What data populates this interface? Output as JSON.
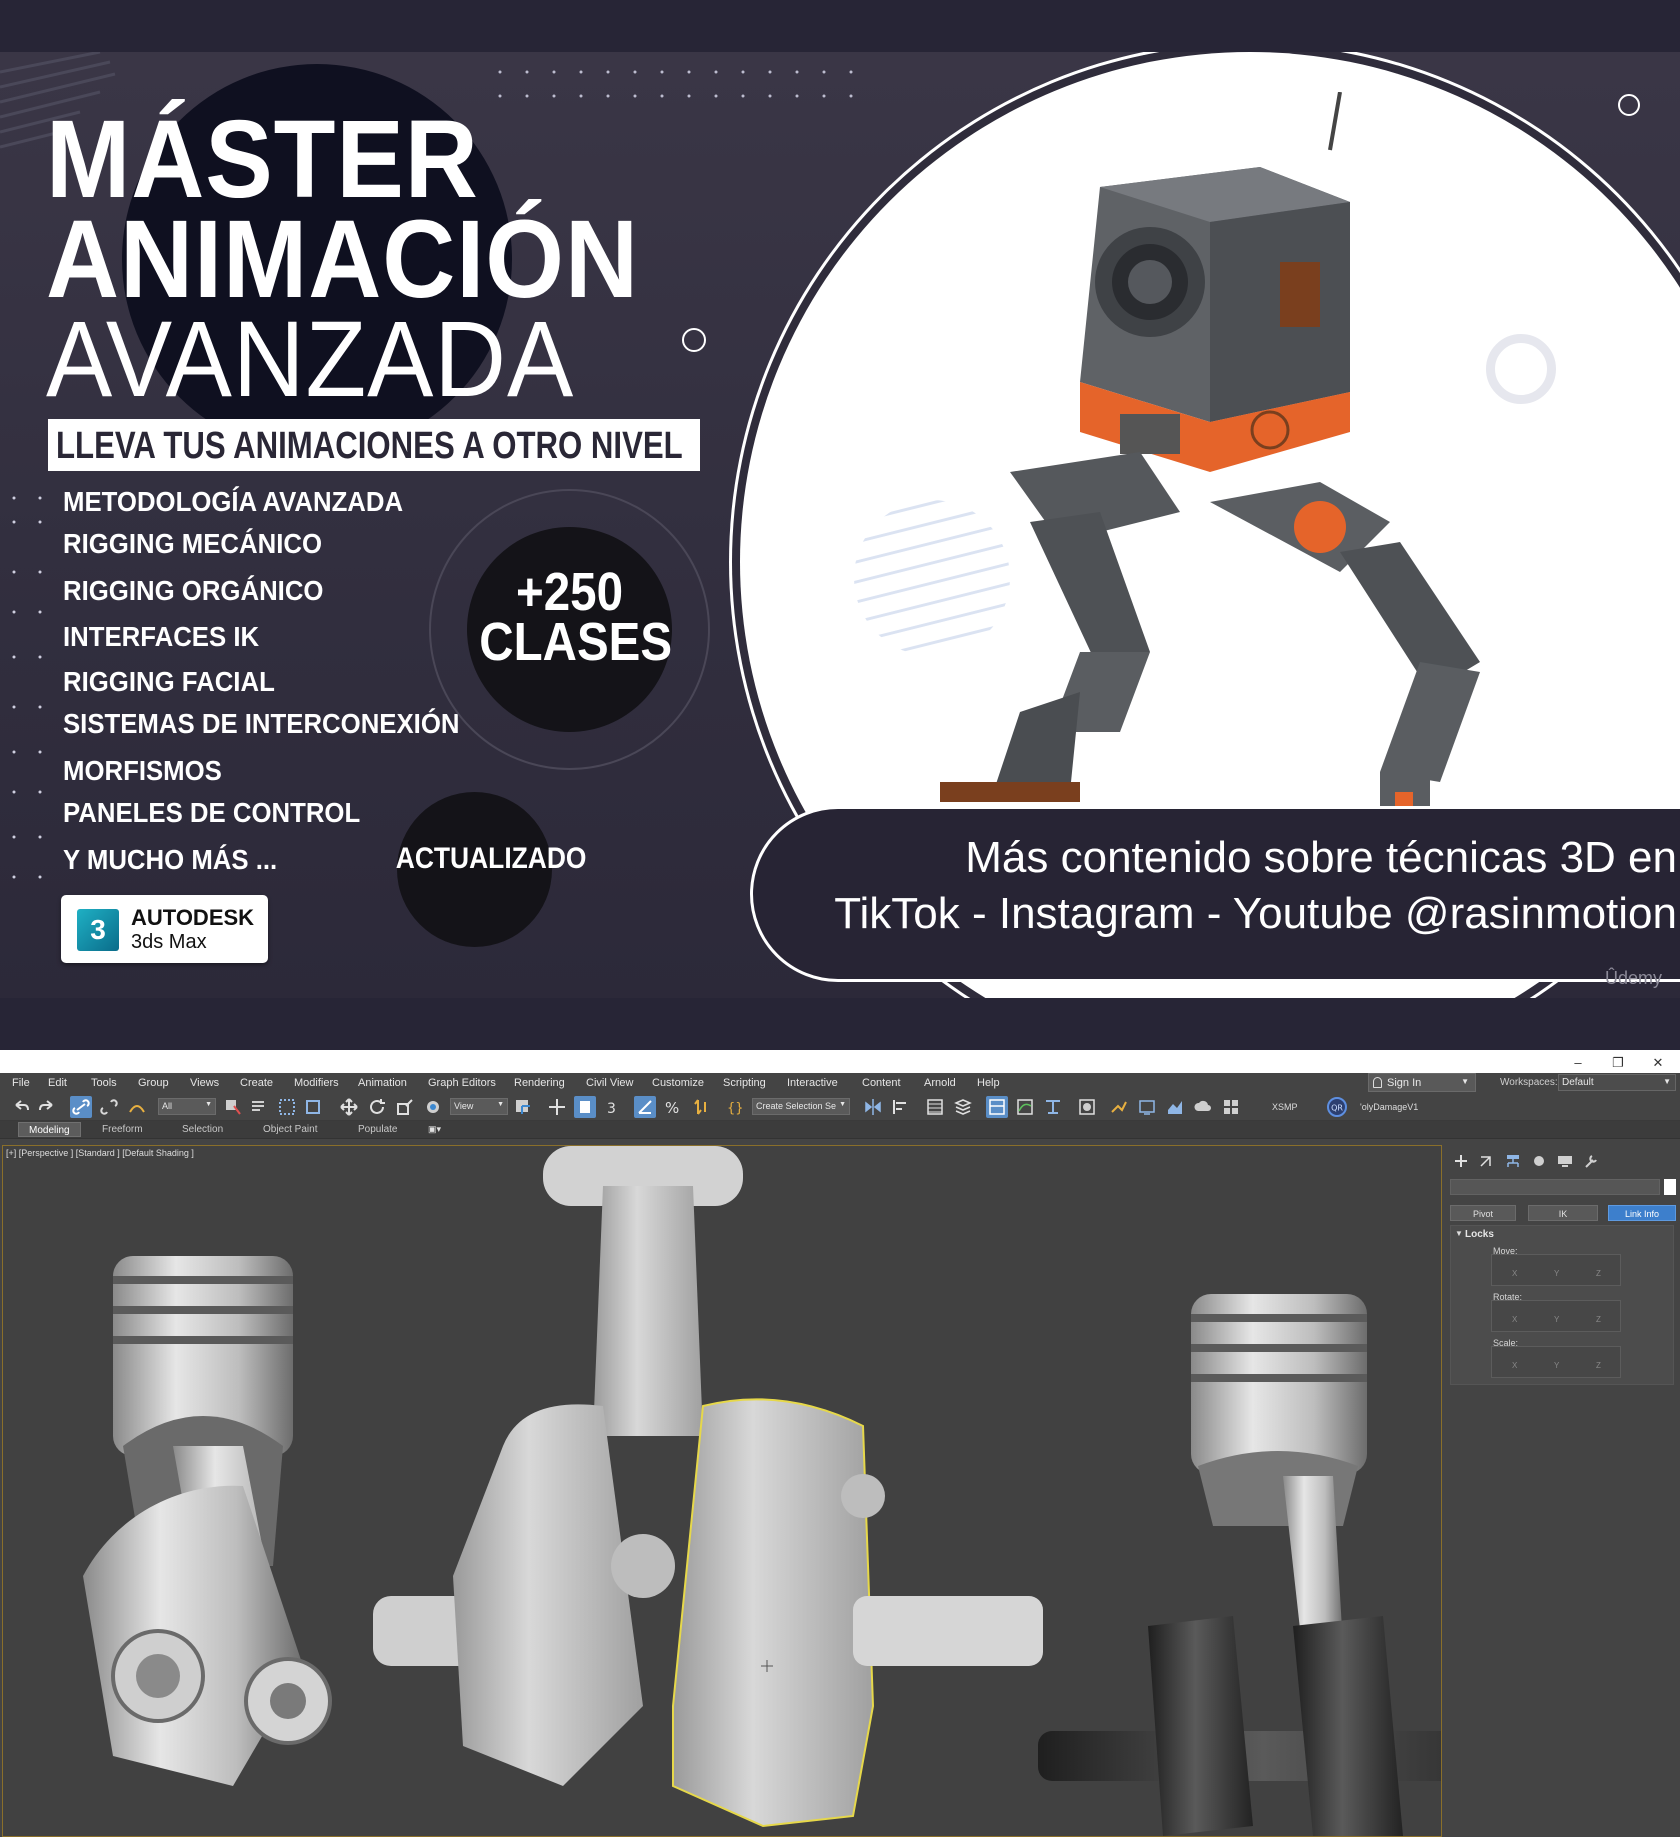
{
  "banner": {
    "title_line1": "MÁSTER",
    "title_line2": "ANIMACIÓN",
    "title_line3": "AVANZADA",
    "subtitle": "LLEVA TUS ANIMACIONES A OTRO NIVEL",
    "features": [
      "METODOLOGÍA AVANZADA",
      "RIGGING MECÁNICO",
      "RIGGING ORGÁNICO",
      "INTERFACES IK",
      "RIGGING FACIAL",
      "SISTEMAS DE INTERCONEXIÓN",
      "MORFISMOS",
      "PANELES DE CONTROL",
      "Y MUCHO MÁS ..."
    ],
    "badge_count": "+250",
    "badge_unit": "CLASES",
    "badge_updated": "ACTUALIZADO",
    "logo_number": "3",
    "logo_brand": "AUTODESK",
    "logo_product": "3ds Max",
    "info_line1": "Más contenido sobre técnicas 3D en",
    "info_line2": "TikTok - Instagram - Youtube @rasinmotion",
    "watermark": "Ûdemy",
    "colors": {
      "background": "#312e3e",
      "accent_orange": "#e5642a",
      "text": "#ffffff"
    }
  },
  "app": {
    "window_controls": {
      "minimize": "–",
      "restore": "❐",
      "close": "✕"
    },
    "menus": [
      "File",
      "Edit",
      "Tools",
      "Group",
      "Views",
      "Create",
      "Modifiers",
      "Animation",
      "Graph Editors",
      "Rendering",
      "Civil View",
      "Customize",
      "Scripting",
      "Interactive",
      "Content",
      "Arnold",
      "Help"
    ],
    "sign_in": "Sign In",
    "workspaces_label": "Workspaces:",
    "workspace_value": "Default",
    "toolbar": {
      "selection_filter": "All",
      "reference_coord": "View",
      "selection_set": "Create Selection Se",
      "xsmp_label": "XSMP",
      "qr_label": "QR",
      "object_name": "'olyDamageV1"
    },
    "ribbon_tabs": [
      "Modeling",
      "Freeform",
      "Selection",
      "Object Paint",
      "Populate"
    ],
    "viewport_label": "[+] [Perspective ] [Standard ] [Default Shading ]",
    "command_panel": {
      "buttons": [
        "Pivot",
        "IK",
        "Link Info"
      ],
      "locks_title": "Locks",
      "move_label": "Move:",
      "rotate_label": "Rotate:",
      "scale_label": "Scale:",
      "axes": [
        "X",
        "Y",
        "Z"
      ]
    },
    "colors": {
      "ui_background": "#444444",
      "selection_highlight": "#e6d84a",
      "active_blue": "#3d7fcc"
    }
  }
}
